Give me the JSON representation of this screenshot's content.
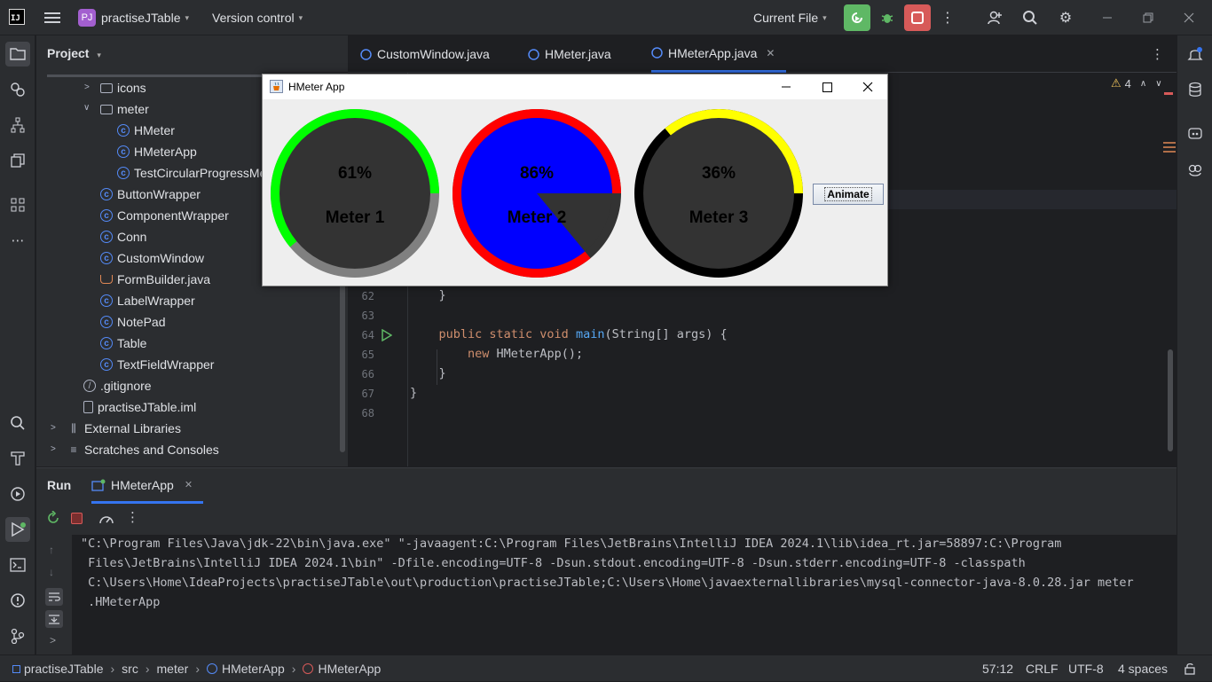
{
  "titlebar": {
    "project_badge": "PJ",
    "project_name": "practiseJTable",
    "vcs": "Version control",
    "run_config": "Current File",
    "logo_text": "IJ"
  },
  "project_panel": {
    "title": "Project",
    "items": [
      {
        "label": "icons",
        "type": "folder"
      },
      {
        "label": "meter",
        "type": "folder"
      },
      {
        "label": "HMeter",
        "type": "class"
      },
      {
        "label": "HMeterApp",
        "type": "class"
      },
      {
        "label": "TestCircularProgressMe",
        "type": "class"
      },
      {
        "label": "ButtonWrapper",
        "type": "class"
      },
      {
        "label": "ComponentWrapper",
        "type": "class"
      },
      {
        "label": "Conn",
        "type": "class"
      },
      {
        "label": "CustomWindow",
        "type": "class"
      },
      {
        "label": "FormBuilder.java",
        "type": "java"
      },
      {
        "label": "LabelWrapper",
        "type": "class"
      },
      {
        "label": "NotePad",
        "type": "class"
      },
      {
        "label": "Table",
        "type": "class"
      },
      {
        "label": "TextFieldWrapper",
        "type": "class"
      },
      {
        "label": ".gitignore",
        "type": "ignore"
      },
      {
        "label": "practiseJTable.iml",
        "type": "file"
      },
      {
        "label": "External Libraries",
        "type": "lib"
      },
      {
        "label": "Scratches and Consoles",
        "type": "scratch"
      }
    ]
  },
  "editor": {
    "tabs": [
      {
        "label": "CustomWindow.java"
      },
      {
        "label": "HMeter.java"
      },
      {
        "label": "HMeterApp.java"
      }
    ],
    "warnings": "4",
    "lines": [
      {
        "num": "62",
        "code": "    }"
      },
      {
        "num": "63",
        "code": ""
      },
      {
        "num": "64",
        "code": "    public static void main(String[] args) {"
      },
      {
        "num": "65",
        "code": "        new HMeterApp();"
      },
      {
        "num": "66",
        "code": "    }"
      },
      {
        "num": "67",
        "code": "}"
      },
      {
        "num": "68",
        "code": ""
      }
    ]
  },
  "swing_window": {
    "title": "HMeter App",
    "animate_label": "Animate",
    "meters": [
      {
        "name": "Meter 1",
        "percent_text": "61%",
        "value": 0.61,
        "arc_color": "#00ff00",
        "track_color": "#808080",
        "fill_color": "#333333"
      },
      {
        "name": "Meter 2",
        "percent_text": "86%",
        "value": 0.86,
        "arc_color": "#ff0000",
        "track_color": "#333333",
        "fill_color": "#0000ff"
      },
      {
        "name": "Meter 3",
        "percent_text": "36%",
        "value": 0.36,
        "arc_color": "#ffff00",
        "track_color": "#000000",
        "fill_color": "#333333"
      }
    ]
  },
  "run_panel": {
    "title": "Run",
    "tab_label": "HMeterApp",
    "console_lines": [
      "\"C:\\Program Files\\Java\\jdk-22\\bin\\java.exe\" \"-javaagent:C:\\Program Files\\JetBrains\\IntelliJ IDEA 2024.1\\lib\\idea_rt.jar=58897:C:\\Program",
      " Files\\JetBrains\\IntelliJ IDEA 2024.1\\bin\" -Dfile.encoding=UTF-8 -Dsun.stdout.encoding=UTF-8 -Dsun.stderr.encoding=UTF-8 -classpath",
      " C:\\Users\\Home\\IdeaProjects\\practiseJTable\\out\\production\\practiseJTable;C:\\Users\\Home\\javaexternallibraries\\mysql-connector-java-8.0.28.jar meter",
      " .HMeterApp"
    ]
  },
  "statusbar": {
    "breadcrumb": [
      "practiseJTable",
      "src",
      "meter",
      "HMeterApp",
      "HMeterApp"
    ],
    "position": "57:12",
    "line_sep": "CRLF",
    "encoding": "UTF-8",
    "indent": "4 spaces"
  },
  "colors": {
    "accent": "#3574f0",
    "run_green": "#5fb865",
    "stop_red": "#d75a59"
  }
}
